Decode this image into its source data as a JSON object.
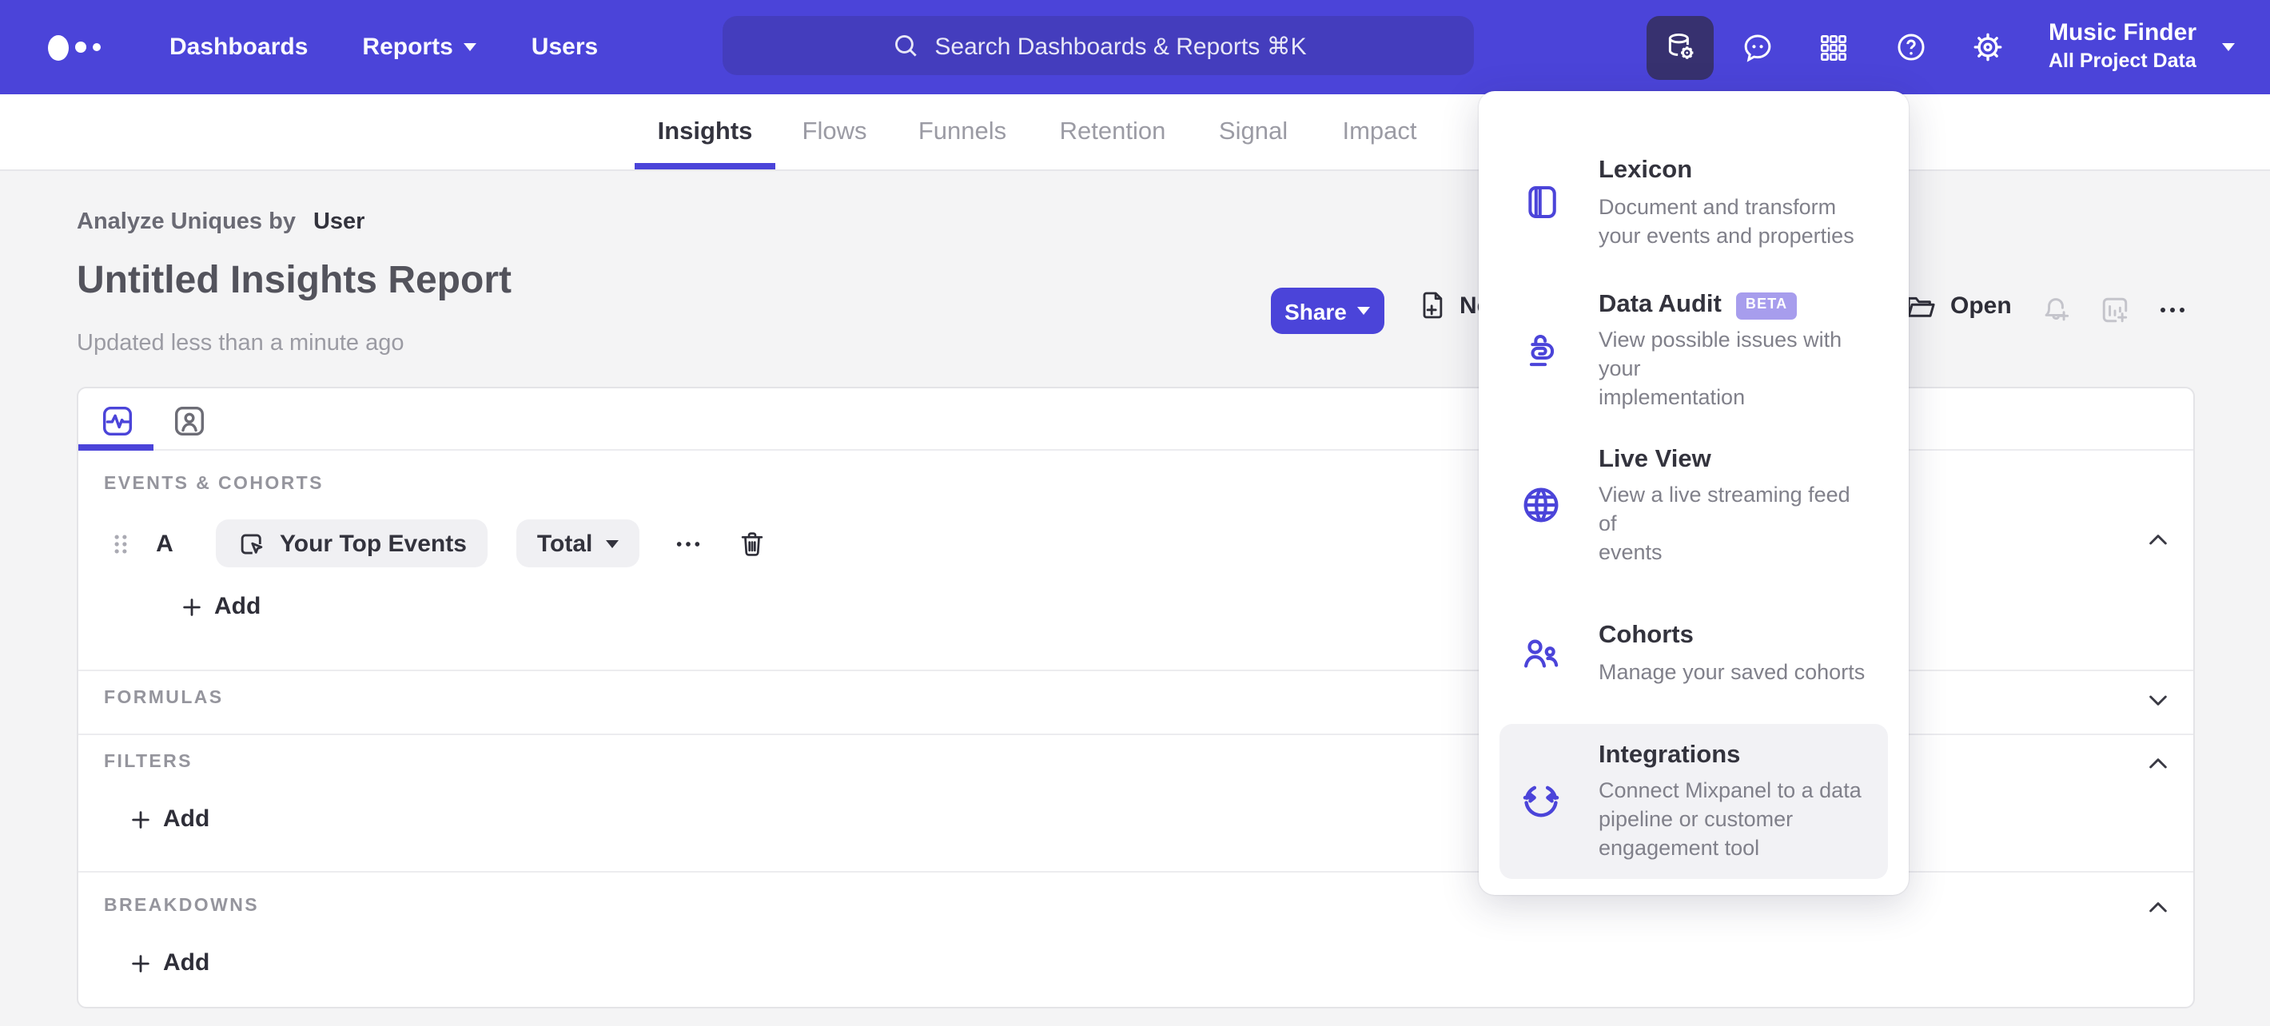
{
  "header": {
    "nav": [
      {
        "label": "Dashboards"
      },
      {
        "label": "Reports"
      },
      {
        "label": "Users"
      }
    ],
    "search_placeholder": "Search Dashboards & Reports ⌘K",
    "icons": [
      "data-management-icon",
      "feedback-icon",
      "apps-grid-icon",
      "help-icon",
      "settings-icon"
    ],
    "project_name": "Music Finder",
    "project_scope": "All Project Data"
  },
  "tabs": [
    {
      "label": "Insights",
      "active": true
    },
    {
      "label": "Flows"
    },
    {
      "label": "Funnels"
    },
    {
      "label": "Retention"
    },
    {
      "label": "Signal"
    },
    {
      "label": "Impact"
    }
  ],
  "report": {
    "analyze_prefix": "Analyze Uniques by",
    "analyze_value": "User",
    "title": "Untitled Insights Report",
    "updated": "Updated less than a minute ago",
    "share_label": "Share",
    "new_label": "New",
    "open_label": "Open"
  },
  "builder": {
    "events_label": "EVENTS & COHORTS",
    "row": {
      "letter": "A",
      "event": "Your Top Events",
      "metric": "Total"
    },
    "add_label": "Add",
    "formulas_label": "FORMULAS",
    "filters_label": "FILTERS",
    "breakdowns_label": "BREAKDOWNS"
  },
  "menu": {
    "items": [
      {
        "title": "Lexicon",
        "icon": "book-icon",
        "desc": [
          "Document and transform",
          "your events and properties"
        ]
      },
      {
        "title": "Data Audit",
        "badge": "BETA",
        "icon": "data-audit-icon",
        "desc": [
          "View possible issues with your",
          "implementation"
        ]
      },
      {
        "title": "Live View",
        "icon": "globe-icon",
        "desc": [
          "View a live streaming feed of",
          "events"
        ]
      },
      {
        "title": "Cohorts",
        "icon": "cohorts-icon",
        "desc": [
          "Manage your saved cohorts"
        ]
      },
      {
        "title": "Integrations",
        "icon": "integrations-icon",
        "highlighted": true,
        "desc": [
          "Connect Mixpanel to a data",
          "pipeline or customer",
          "engagement tool"
        ]
      }
    ]
  },
  "colors": {
    "accent": "#4b44d9",
    "header_bg": "#4b44d9",
    "search_bg": "#443dbd",
    "active_icon_bg": "#37316f",
    "badge_bg": "#a79ded",
    "page_bg": "#f4f4f5",
    "muted_text": "#9b9ba3",
    "dark_text": "#2e2e38"
  }
}
